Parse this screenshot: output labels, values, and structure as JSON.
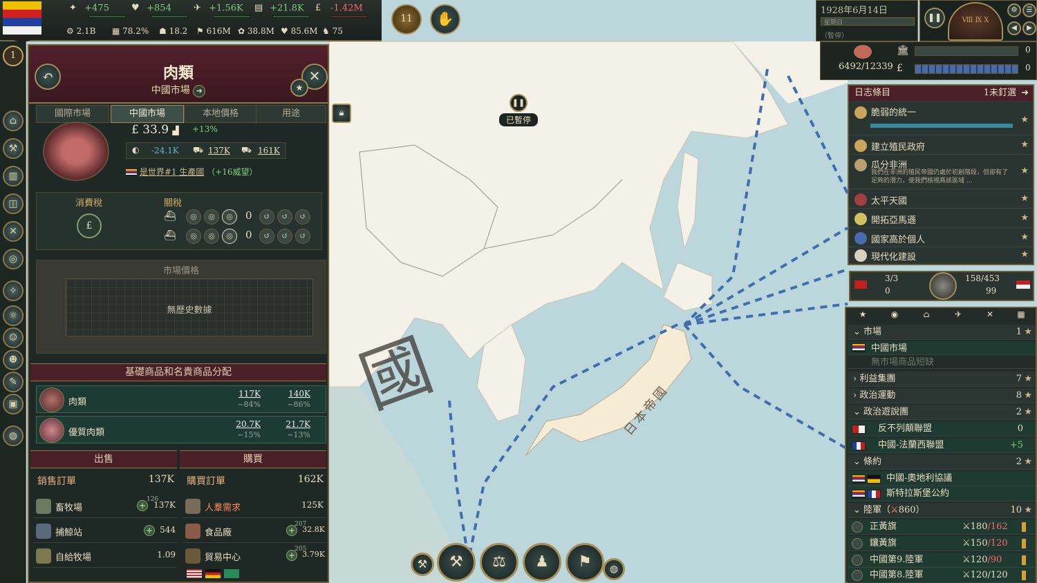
{
  "topbar": {
    "resources": [
      {
        "value": "+475",
        "tone": "pos"
      },
      {
        "value": "+854",
        "tone": "pos"
      },
      {
        "value": "+1.56K",
        "tone": "pos"
      },
      {
        "value": "+21.8K",
        "tone": "pos"
      },
      {
        "value": "-1.42M",
        "tone": "neg"
      }
    ],
    "stats": [
      "2.1B",
      "78.2%",
      "18.2",
      "616M",
      "38.8M",
      "85.6M",
      "75"
    ],
    "rank_badge": "1",
    "alert_count": "11"
  },
  "panel": {
    "title": "肉類",
    "subtitle": "中國市場",
    "tabs": [
      "國際市場",
      "中國市場",
      "本地價格",
      "用途"
    ],
    "price": "£ 33.9",
    "price_change": "+13%",
    "balance": "-24.1K",
    "buy": "137K",
    "sell": "161K",
    "producer_prefix": "是世界#1 生產國",
    "producer_prestige": "（+16威望）",
    "consumption_tax_label": "消費稅",
    "tariff_label": "關稅",
    "tariff_value_1": "0",
    "tariff_value_2": "0",
    "price_chart_title": "市場價格",
    "no_history": "無歷史數據",
    "distribution_title": "基礎商品和名貴商品分配",
    "goods": [
      {
        "name": "肉類",
        "buy": "117K",
        "buy_pct": "~84%",
        "sell": "140K",
        "sell_pct": "~86%"
      },
      {
        "name": "優質肉類",
        "buy": "20.7K",
        "buy_pct": "~15%",
        "sell": "21.7K",
        "sell_pct": "~13%"
      }
    ],
    "sell_header": "出售",
    "buy_header": "購買",
    "sell_orders_label": "銷售訂單",
    "sell_orders_total": "137K",
    "buy_orders_label": "購買訂單",
    "buy_orders_total": "162K",
    "sellers": [
      {
        "name": "畜牧場",
        "badge": "126",
        "value": "137K"
      },
      {
        "name": "捕鯨站",
        "badge": "",
        "value": "544"
      },
      {
        "name": "自給牧場",
        "badge": "",
        "value": "1.09"
      }
    ],
    "buyers": [
      {
        "name": "人羣需求",
        "badge": "",
        "value": "125K"
      },
      {
        "name": "食品廠",
        "badge": "207",
        "value": "32.8K"
      },
      {
        "name": "貿易中心",
        "badge": "205",
        "value": "3.79K"
      }
    ]
  },
  "map": {
    "paused_label": "已暫停",
    "country_label": "日本帝國",
    "country_big_char": "國"
  },
  "right": {
    "date": "1928年6月14日",
    "speed_label": "星期日",
    "paused_small": "（暫停）",
    "stat_value": "6492/12339",
    "bar_value_1": "0",
    "bar_value_2": "0",
    "journal_title": "日志條目",
    "journal_pinned": "1未釘選",
    "journal_items": [
      {
        "title": "脆弱的統一",
        "desc": ""
      },
      {
        "title": "建立殖民政府",
        "desc": ""
      },
      {
        "title": "瓜分非洲",
        "desc": "我們在非洲的殖民帝國仍處於初創階段，但卻有了足夠的潛力，使我們核視爲該區域 ..."
      },
      {
        "title": "太平天國",
        "desc": ""
      },
      {
        "title": "開拓亞馬遜",
        "desc": ""
      },
      {
        "title": "國家高於個人",
        "desc": ""
      },
      {
        "title": "現代化建設",
        "desc": ""
      }
    ],
    "mil_left_top": "3/3",
    "mil_left_bottom": "0",
    "mil_right_top": "158/453",
    "mil_right_bottom": "99",
    "outliner": {
      "market_header": "市場",
      "market_count": "1",
      "market_name": "中國市場",
      "market_note": "無市場商品短缺",
      "ig_header": "利益集團",
      "ig_count": "7",
      "pm_header": "政治運動",
      "pm_count": "8",
      "pl_header": "政治遊說團",
      "pl_count": "2",
      "lobbies": [
        {
          "name": "反不列顛聯盟",
          "value": "0"
        },
        {
          "name": "中國-法蘭西聯盟",
          "value": "+5"
        }
      ],
      "treaty_header": "條約",
      "treaty_count": "2",
      "treaties": [
        "中國-奧地利協議",
        "斯特拉斯堡公約"
      ],
      "army_header": "陸軍（",
      "army_size": "860",
      "army_header_end": "）",
      "army_count": "10",
      "armies": [
        {
          "name": "正黃旗",
          "cur": "180",
          "max": "/162"
        },
        {
          "name": "鑲黃旗",
          "cur": "150",
          "max": "/120"
        },
        {
          "name": "中國第9.陸軍",
          "cur": "120",
          "max": "/90"
        },
        {
          "name": "中國第8.陸軍",
          "cur": "120",
          "max": "/120"
        }
      ]
    }
  },
  "colors": {
    "positive": "#7fd27f",
    "negative": "#ff6868",
    "panel_header": "#53202a",
    "sea": "#bcd7dc",
    "land": "#f4f1e8",
    "route": "#3f6db0"
  }
}
